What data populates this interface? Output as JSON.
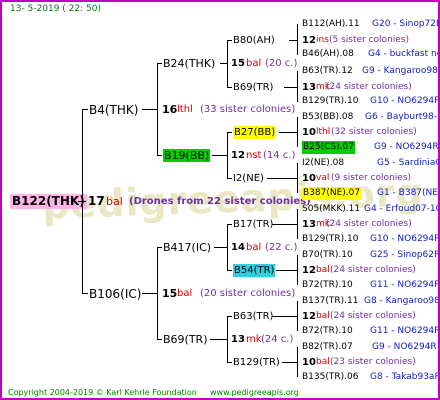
{
  "header": {
    "date": "13-  5-2019 (  22:  50)"
  },
  "footer": {
    "copyright": "Copyright 2004-2019 © Karl Kehrle Foundation",
    "url": "www.pedigreeapis.org"
  },
  "watermark": "pedigreeapis.org",
  "root": {
    "name": "B122(THK)",
    "num": "17",
    "word": "bal",
    "note": "(Drones from 22 sister colonies)"
  },
  "g1": [
    {
      "name": "B4(THK)",
      "num": "16",
      "word": "lthl",
      "note": "(33 sister colonies)"
    },
    {
      "name": "B106(IC)",
      "num": "15",
      "word": "bal",
      "note": "(20 sister colonies)"
    }
  ],
  "g2": [
    {
      "name": "B24(THK)",
      "num": "15",
      "word": "bal",
      "note": "(20 c.)"
    },
    {
      "name": "B19(BB)",
      "num": "12",
      "word": "nst",
      "note": "(14 c.)"
    },
    {
      "name": "B417(IC)",
      "num": "14",
      "word": "bal",
      "note": "(22 c.)"
    },
    {
      "name": "B69(TR)",
      "num": "13",
      "word": "mk",
      "note": "(24 c.)"
    }
  ],
  "g3": [
    "B80(AH)",
    "B69(TR)",
    "B27(BB)",
    "I2(NE)",
    "B17(TR)",
    "B54(TR)",
    "B63(TR)",
    "B129(TR)"
  ],
  "right": [
    {
      "name": "B112(AH).11",
      "code": "G20 - Sinop72R"
    },
    {
      "num": "12",
      "word": "ins",
      "note": "(5 sister colonies)"
    },
    {
      "name": "B46(AH).08",
      "code": "G4 - buckfast no"
    },
    {
      "name": "B63(TR).12",
      "code": "G9 - Kangaroo98R"
    },
    {
      "num": "13",
      "word": "mk",
      "note": "(24 sister colonies)"
    },
    {
      "name": "B129(TR).10",
      "code": "G10 - NO6294R"
    },
    {
      "name": "B53(BB).08",
      "code": "G6 - Bayburt98-3"
    },
    {
      "num": "10",
      "word": "lthl",
      "note": "(32 sister colonies)"
    },
    {
      "name": "B25(CS).07",
      "code": "G9 - NO6294R"
    },
    {
      "name": "I2(NE).08",
      "code": "G5 - SardiniaQ"
    },
    {
      "num": "10",
      "word": "val",
      "note": "(9 sister colonies)"
    },
    {
      "name": "B387(NE).07",
      "code": "G1 - B387(NE)"
    },
    {
      "name": "S05(MKK).11",
      "code": "G4 - Erfoud07-1Q"
    },
    {
      "num": "13",
      "word": "mk",
      "note": "(24 sister colonies)"
    },
    {
      "name": "B129(TR).10",
      "code": "G10 - NO6294R"
    },
    {
      "name": "B70(TR).10",
      "code": "G25 - Sinop62R"
    },
    {
      "num": "12",
      "word": "bal",
      "note": "(24 sister colonies)"
    },
    {
      "name": "B72(TR).10",
      "code": "G11 - NO6294R"
    },
    {
      "name": "B137(TR).11",
      "code": "G8 - Kangaroo98R"
    },
    {
      "num": "12",
      "word": "bal",
      "note": "(24 sister colonies)"
    },
    {
      "name": "B72(TR).10",
      "code": "G11 - NO6294R"
    },
    {
      "name": "B82(TR).07",
      "code": "G9 - NO6294R"
    },
    {
      "num": "10",
      "word": "bal",
      "note": "(23 sister colonies)"
    },
    {
      "name": "B135(TR).06",
      "code": "G8 - Takab93aR"
    }
  ]
}
